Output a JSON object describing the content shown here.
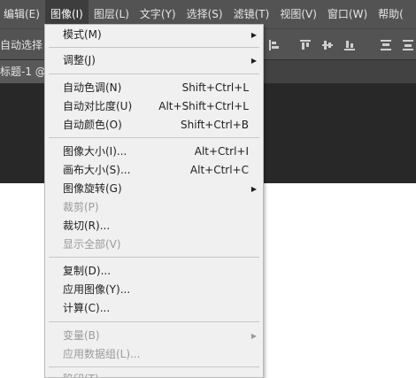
{
  "menubar": {
    "items": [
      {
        "label": "编辑(E)"
      },
      {
        "label": "图像(I)"
      },
      {
        "label": "图层(L)"
      },
      {
        "label": "文字(Y)"
      },
      {
        "label": "选择(S)"
      },
      {
        "label": "滤镜(T)"
      },
      {
        "label": "视图(V)"
      },
      {
        "label": "窗口(W)"
      },
      {
        "label": "帮助("
      }
    ]
  },
  "options_bar": {
    "auto_select_label": "自动选择："
  },
  "document_tab": {
    "label": "标题-1 @"
  },
  "image_menu": {
    "items": [
      {
        "label": "模式(M)",
        "has_submenu": true
      },
      {
        "label": "调整(J)",
        "has_submenu": true
      },
      {
        "label": "自动色调(N)",
        "shortcut": "Shift+Ctrl+L"
      },
      {
        "label": "自动对比度(U)",
        "shortcut": "Alt+Shift+Ctrl+L"
      },
      {
        "label": "自动颜色(O)",
        "shortcut": "Shift+Ctrl+B"
      },
      {
        "label": "图像大小(I)...",
        "shortcut": "Alt+Ctrl+I"
      },
      {
        "label": "画布大小(S)...",
        "shortcut": "Alt+Ctrl+C"
      },
      {
        "label": "图像旋转(G)",
        "has_submenu": true
      },
      {
        "label": "裁剪(P)",
        "disabled": true
      },
      {
        "label": "裁切(R)..."
      },
      {
        "label": "显示全部(V)",
        "disabled": true
      },
      {
        "label": "复制(D)..."
      },
      {
        "label": "应用图像(Y)..."
      },
      {
        "label": "计算(C)..."
      },
      {
        "label": "变量(B)",
        "has_submenu": true,
        "disabled": true
      },
      {
        "label": "应用数据组(L)...",
        "disabled": true
      },
      {
        "label": "陷印(T)...",
        "disabled": true
      }
    ]
  },
  "colors": {
    "menubar_bg": "#535353",
    "menu_bg": "#f0f0f0",
    "disabled_text": "#9a9a9a",
    "workspace_bg": "#282828"
  }
}
